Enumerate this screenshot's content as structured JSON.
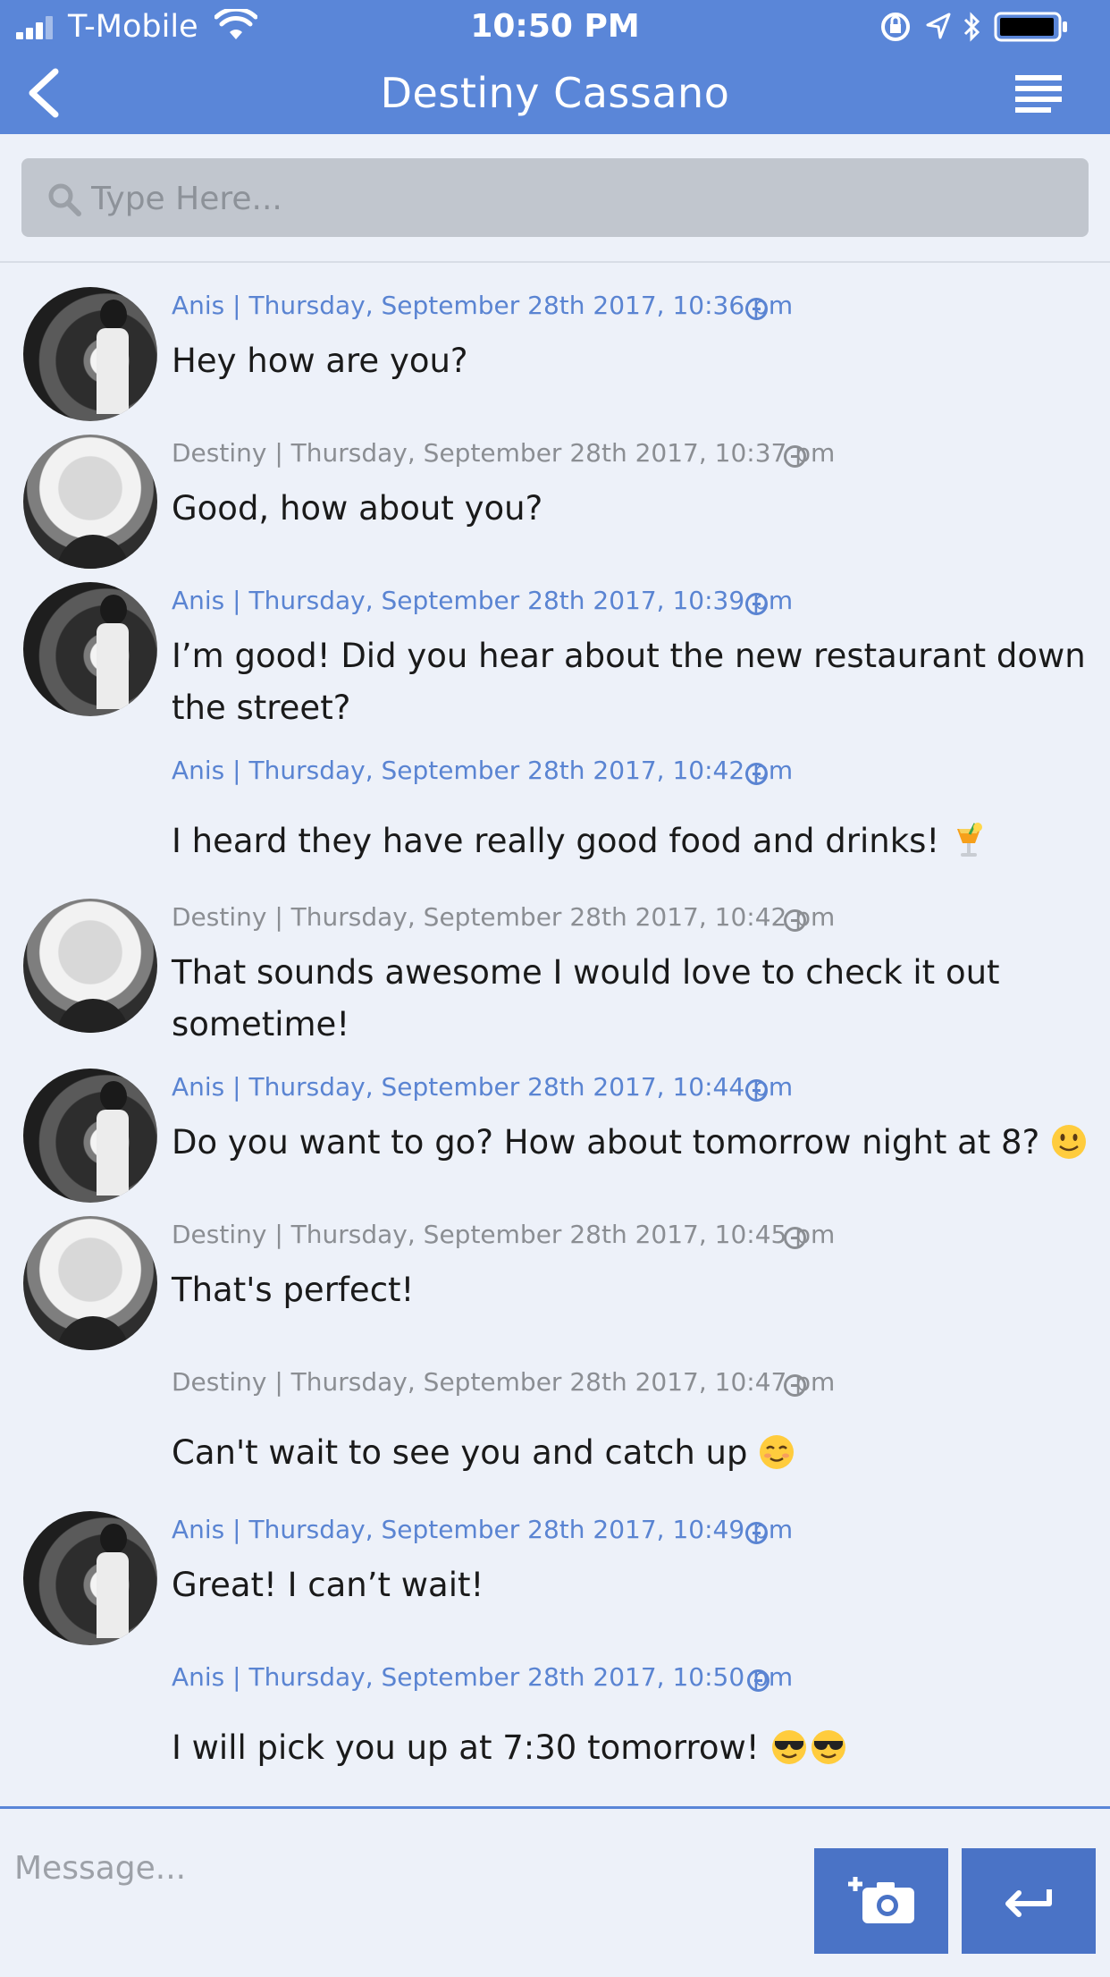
{
  "status_bar": {
    "carrier": "T-Mobile",
    "time": "10:50 PM"
  },
  "header": {
    "title": "Destiny Cassano"
  },
  "search": {
    "placeholder": "Type Here..."
  },
  "messages": [
    {
      "meta": "Anis | Thursday, September 28th 2017, 10:36 pm",
      "text": "Hey how are you?"
    },
    {
      "meta": "Destiny | Thursday, September 28th 2017, 10:37 pm",
      "text": "Good, how about you?"
    },
    {
      "meta": "Anis | Thursday, September 28th 2017, 10:39 pm",
      "text": "I’m good! Did you hear about the new restaurant down the street?"
    },
    {
      "meta": "Anis | Thursday, September 28th 2017, 10:42 pm",
      "text": "I heard they have really good food and drinks!"
    },
    {
      "meta": "Destiny | Thursday, September 28th 2017, 10:42 pm",
      "text": "That sounds awesome I would love to check it out sometime!"
    },
    {
      "meta": "Anis | Thursday, September 28th 2017, 10:44 pm",
      "text": "Do you want to go? How about tomorrow night at 8?"
    },
    {
      "meta": "Destiny | Thursday, September 28th 2017, 10:45 pm",
      "text": "That's perfect!"
    },
    {
      "meta": "Destiny | Thursday, September 28th 2017, 10:47 pm",
      "text": "Can't wait to see you and catch up"
    },
    {
      "meta": "Anis | Thursday, September 28th 2017, 10:49 pm",
      "text": "Great! I can’t wait!"
    },
    {
      "meta": "Anis | Thursday, September 28th 2017, 10:50 pm",
      "text": "I will pick you up at 7:30 tomorrow!"
    }
  ],
  "emoji": {
    "m3": "tropical-drink-icon",
    "m5": "slightly-smiling-face-icon",
    "m7": "smiling-face-icon",
    "m9": "sunglasses-face-icon"
  },
  "composer": {
    "placeholder": "Message..."
  },
  "colors": {
    "header": "#5a86d8",
    "anis": "#5a84d2",
    "destiny": "#8b8e93",
    "button": "#4a73c6",
    "background": "#edf1f9"
  }
}
